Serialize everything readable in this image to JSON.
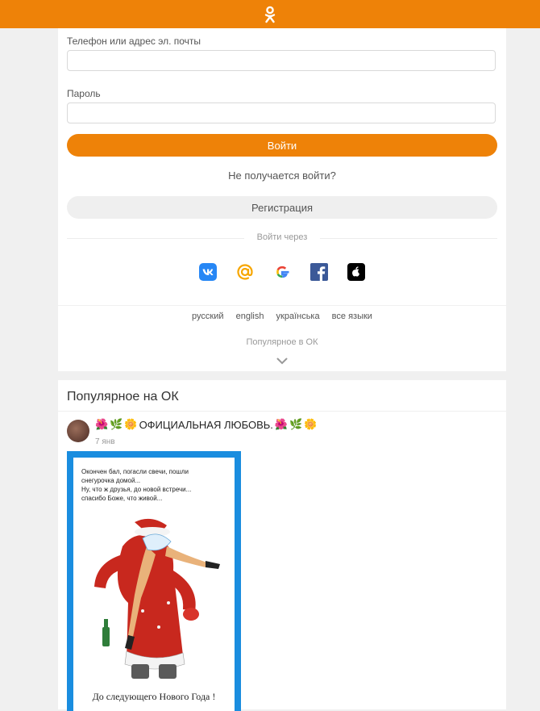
{
  "header": {
    "logo_icon": "ok-logo-icon",
    "brand_color": "#ee8208"
  },
  "login": {
    "phone_label": "Телефон или адрес эл. почты",
    "phone_value": "",
    "password_label": "Пароль",
    "password_value": "",
    "login_button": "Войти",
    "trouble_link": "Не получается войти?",
    "register_button": "Регистрация",
    "login_via": "Войти через",
    "social_icons": [
      "vk-icon",
      "mail-ru-icon",
      "google-icon",
      "facebook-icon",
      "apple-icon"
    ]
  },
  "languages": [
    "русский",
    "english",
    "українська",
    "все языки"
  ],
  "popular_link": "Популярное в ОК",
  "feed": {
    "title": "Популярное на ОК",
    "post": {
      "emoji_left": [
        "🌺",
        "🌿",
        "🌼"
      ],
      "title": "ОФИЦИАЛЬНАЯ ЛЮБОВЬ.",
      "emoji_right": [
        "🌺",
        "🌿",
        "🌼"
      ],
      "date": "7 янв",
      "poem_lines": [
        "Окончен бал, погасли свечи, пошли",
        "снегурочка домой...",
        "Ну, что ж друзья, до новой встречи...",
        "спасибо Боже, что живой..."
      ],
      "caption": "До следующего Нового Года !"
    }
  }
}
